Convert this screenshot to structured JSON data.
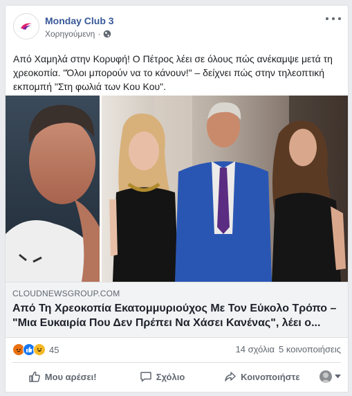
{
  "post": {
    "page_name": "Monday Club 3",
    "meta_label": "Χορηγούμενη",
    "meta_separator": "·",
    "text": "Από Χαμηλά στην Κορυφή! Ο Πέτρος λέει σε όλους πώς ανέκαμψε μετά τη χρεοκοπία. \"Όλοι μπορούν να το κάνουν!\" – δείχνει πώς στην τηλεοπτική εκπομπή \"Στη φωλιά των Κου Κου\"."
  },
  "link": {
    "domain": "CLOUDNEWSGROUP.COM",
    "title": "Από Τη Χρεοκοπία Εκατομμυριούχος Με Τον Εύκολο Τρόπο – \"Μια Ευκαιρία Που Δεν Πρέπει Να Χάσει Κανένας\", λέει ο..."
  },
  "engagement": {
    "reaction_count": "45",
    "comments": "14 σχόλια",
    "shares": "5 κοινοποιήσεις",
    "reaction_icons": [
      "angry-icon",
      "like-icon",
      "haha-icon"
    ]
  },
  "actions": {
    "like": "Μου αρέσει!",
    "comment": "Σχόλιο",
    "share": "Κοινοποιήστε"
  },
  "colors": {
    "link_blue": "#385898",
    "muted": "#606770",
    "background": "#e9ebee"
  }
}
